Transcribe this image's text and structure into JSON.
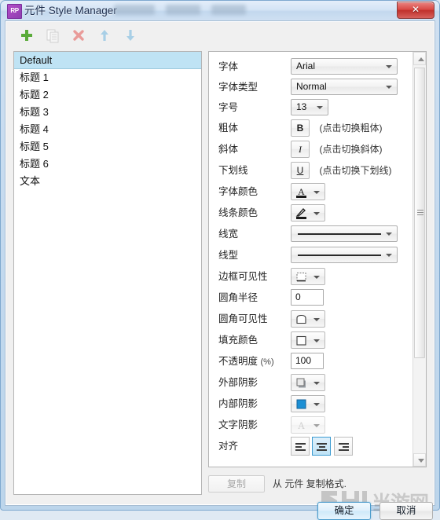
{
  "window": {
    "title": "元件 Style Manager",
    "app_icon_label": "RP",
    "close_label": "✕",
    "redacted_segments": 3
  },
  "toolbar": {
    "items": [
      {
        "name": "add",
        "icon": "plus-icon",
        "color": "#5aab3a",
        "enabled": true
      },
      {
        "name": "duplicate",
        "icon": "copy-icon",
        "color": "#cfcfcf",
        "enabled": false
      },
      {
        "name": "delete",
        "icon": "close-x-icon",
        "color": "#e99b99",
        "enabled": false
      },
      {
        "name": "move-up",
        "icon": "arrow-up-icon",
        "color": "#a8cfe6",
        "enabled": false
      },
      {
        "name": "move-down",
        "icon": "arrow-down-icon",
        "color": "#a8cfe6",
        "enabled": false
      }
    ]
  },
  "style_list": {
    "selected": "Default",
    "items": [
      "标题 1",
      "标题 2",
      "标题 3",
      "标题 4",
      "标题 5",
      "标题 6",
      "文本"
    ]
  },
  "properties": {
    "rows": [
      {
        "label": "字体",
        "type": "combo",
        "value": "Arial"
      },
      {
        "label": "字体类型",
        "type": "combo",
        "value": "Normal"
      },
      {
        "label": "字号",
        "type": "combo-sm",
        "value": "13"
      },
      {
        "label": "粗体",
        "type": "toggle",
        "value": "B",
        "hint": "(点击切换粗体)"
      },
      {
        "label": "斜体",
        "type": "toggle",
        "value": "I",
        "hint": "(点击切换斜体)"
      },
      {
        "label": "下划线",
        "type": "toggle",
        "value": "U",
        "hint": "(点击切换下划线)"
      },
      {
        "label": "字体颜色",
        "type": "swatch",
        "icon": "font-color-icon",
        "swatch": "#1a1a1a"
      },
      {
        "label": "线条颜色",
        "type": "swatch",
        "icon": "line-color-icon",
        "swatch": "#1a1a1a"
      },
      {
        "label": "线宽",
        "type": "line",
        "value": ""
      },
      {
        "label": "线型",
        "type": "line",
        "value": ""
      },
      {
        "label": "边框可见性",
        "type": "swatch",
        "icon": "border-visibility-icon"
      },
      {
        "label": "圆角半径",
        "type": "text",
        "value": "0"
      },
      {
        "label": "圆角可见性",
        "type": "swatch",
        "icon": "corner-visibility-icon"
      },
      {
        "label": "填充颜色",
        "type": "swatch",
        "icon": "fill-color-icon",
        "swatch": "#ffffff"
      },
      {
        "label": "不透明度",
        "unit": "(%)",
        "type": "text",
        "value": "100"
      },
      {
        "label": "外部阴影",
        "type": "swatch",
        "icon": "outer-shadow-icon"
      },
      {
        "label": "内部阴影",
        "type": "swatch",
        "icon": "inner-shadow-icon",
        "swatch": "#1b8fd4"
      },
      {
        "label": "文字阴影",
        "type": "swatch",
        "icon": "text-shadow-icon",
        "disabled": true
      },
      {
        "label": "对齐",
        "type": "align",
        "selected_index": 1,
        "options": [
          "align-left",
          "align-center",
          "align-right"
        ]
      }
    ]
  },
  "footer": {
    "copy_label": "复制",
    "copy_note": "从 元件 复制格式.",
    "ok_label": "确定",
    "cancel_label": "取消"
  },
  "watermark": {
    "text": "当游网"
  },
  "colors": {
    "selection": "#bfe3f4",
    "accent": "#3c9bd1",
    "add_green": "#5aab3a",
    "delete_red": "#e07070"
  }
}
